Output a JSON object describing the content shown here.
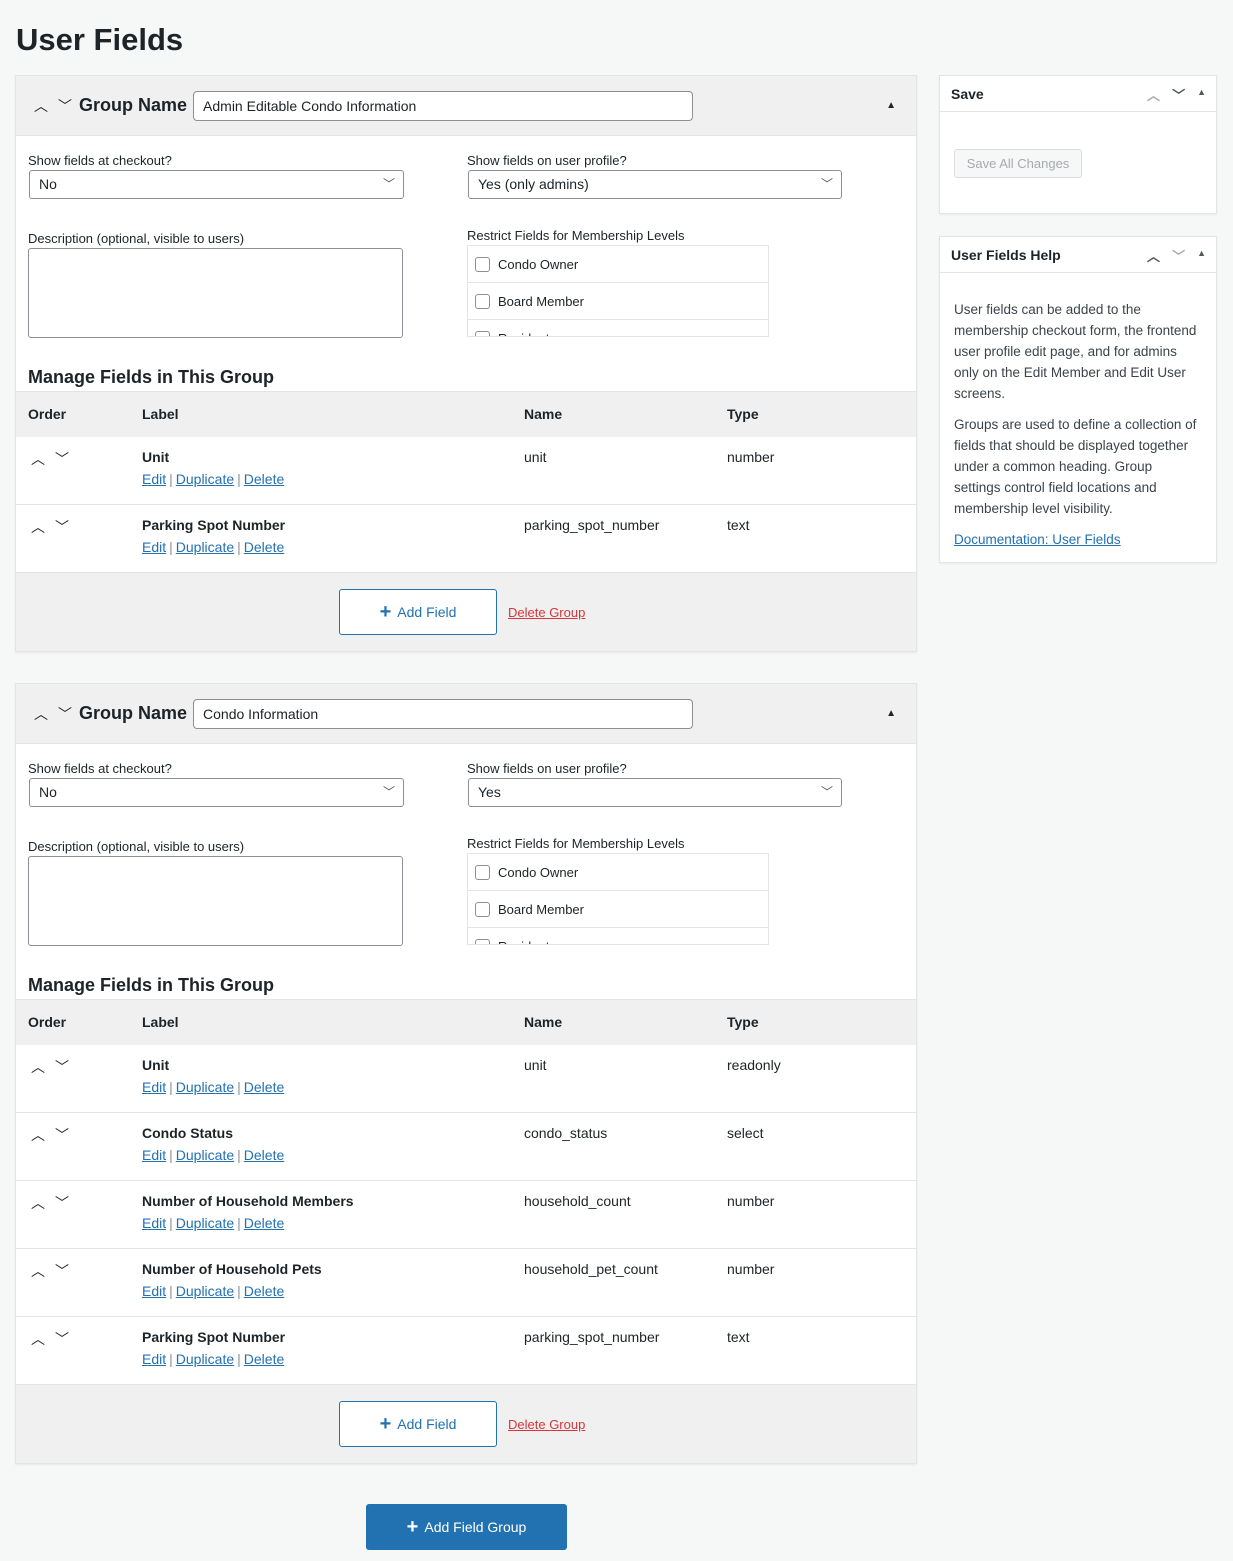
{
  "page_title": "User Fields",
  "common": {
    "group_name_label": "Group Name",
    "checkout_label": "Show fields at checkout?",
    "profile_label": "Show fields on user profile?",
    "description_label": "Description (optional, visible to users)",
    "restrict_label": "Restrict Fields for Membership Levels",
    "manage_heading": "Manage Fields in This Group",
    "columns": [
      "Order",
      "Label",
      "Name",
      "Type"
    ],
    "actions": [
      "Edit",
      "Duplicate",
      "Delete"
    ],
    "add_field": "Add Field",
    "delete_group": "Delete Group",
    "levels": [
      "Condo Owner",
      "Board Member",
      "Resident"
    ]
  },
  "groups": [
    {
      "name": "Admin Editable Condo Information",
      "checkout": "No",
      "profile": "Yes (only admins)",
      "fields": [
        {
          "label": "Unit",
          "name": "unit",
          "type": "number"
        },
        {
          "label": "Parking Spot Number",
          "name": "parking_spot_number",
          "type": "text"
        }
      ]
    },
    {
      "name": "Condo Information",
      "checkout": "No",
      "profile": "Yes",
      "fields": [
        {
          "label": "Unit",
          "name": "unit",
          "type": "readonly"
        },
        {
          "label": "Condo Status",
          "name": "condo_status",
          "type": "select"
        },
        {
          "label": "Number of Household Members",
          "name": "household_count",
          "type": "number"
        },
        {
          "label": "Number of Household Pets",
          "name": "household_pet_count",
          "type": "number"
        },
        {
          "label": "Parking Spot Number",
          "name": "parking_spot_number",
          "type": "text"
        }
      ]
    }
  ],
  "add_field_group": "Add Field Group",
  "save_box": {
    "title": "Save",
    "button": "Save All Changes"
  },
  "help_box": {
    "title": "User Fields Help",
    "p1": "User fields can be added to the membership checkout form, the frontend user profile edit page, and for admins only on the Edit Member and Edit User screens.",
    "p2": "Groups are used to define a collection of fields that should be displayed together under a common heading. Group settings control field locations and membership level visibility.",
    "link": "Documentation: User Fields"
  },
  "colors": {
    "accent": "#2271b1",
    "danger": "#d63638"
  }
}
